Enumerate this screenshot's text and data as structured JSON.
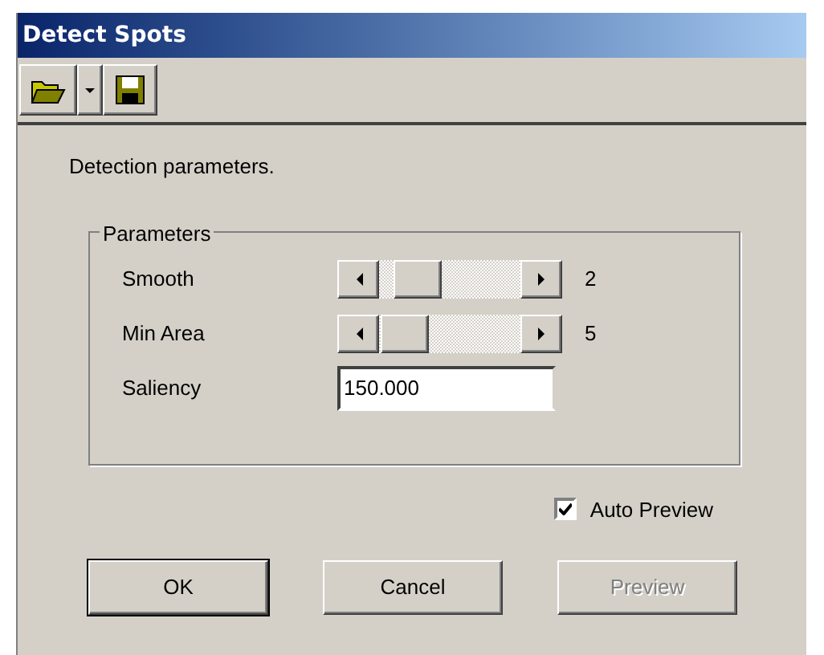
{
  "window": {
    "title": "Detect Spots"
  },
  "description": "Detection parameters.",
  "group": {
    "title": "Parameters",
    "rows": [
      {
        "kind": "slider",
        "label": "Smooth",
        "level": 0.15,
        "reading": "2"
      },
      {
        "kind": "slider",
        "label": "Min Area",
        "level": 0.02,
        "reading": "5"
      },
      {
        "kind": "field",
        "label": "Saliency",
        "value": "150.000"
      }
    ]
  },
  "auto_preview": {
    "label": "Auto Preview",
    "checked": true
  },
  "buttons": [
    {
      "label": "OK",
      "default": true,
      "disabled": false
    },
    {
      "label": "Cancel",
      "default": false,
      "disabled": false
    },
    {
      "label": "Preview",
      "default": false,
      "disabled": true
    }
  ]
}
